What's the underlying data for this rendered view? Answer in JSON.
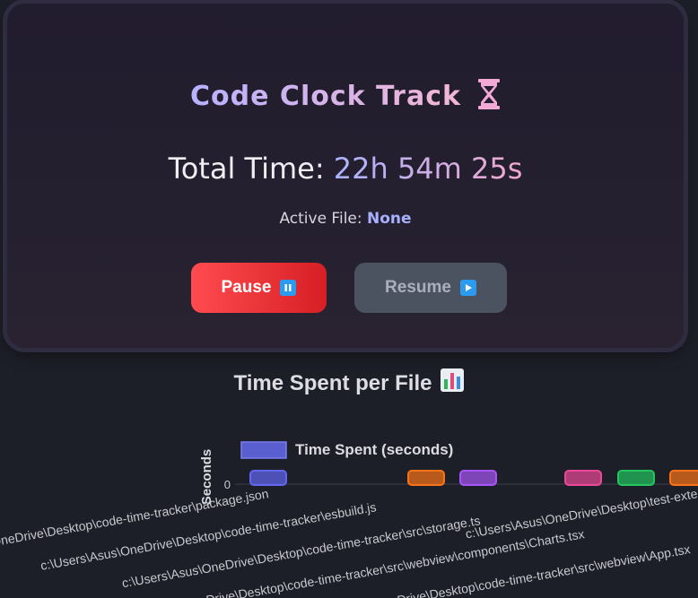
{
  "app": {
    "title": "Code Clock Track",
    "title_icon": "hourglass-icon"
  },
  "stats": {
    "total_label": "Total Time:",
    "total_value": "22h 54m 25s",
    "active_label": "Active File:",
    "active_value": "None"
  },
  "controls": {
    "pause_label": "Pause",
    "pause_icon": "pause-icon",
    "resume_label": "Resume",
    "resume_icon": "play-icon"
  },
  "chart_section": {
    "title": "Time Spent per File",
    "title_icon": "bar-chart-icon"
  },
  "colors": {
    "pause_bg": "#e53236",
    "resume_bg": "#4b5361",
    "accent": "#a7b1ff"
  },
  "chart_data": {
    "type": "bar",
    "legend": "Time Spent (seconds)",
    "legend_placement": "top",
    "ylabel": "Seconds",
    "yticks": [
      "0"
    ],
    "categories": [
      "c:\\Users\\Asus\\OneDrive\\Desktop\\code-time-tracker\\package.json",
      "c:\\Users\\Asus\\OneDrive\\Desktop\\code-time-tracker\\esbuild.js",
      "c:\\Users\\Asus\\OneDrive\\Desktop\\code-time-tracker\\src\\storage.ts",
      "c:\\Users\\Asus\\OneDrive\\Desktop\\code-time-tracker\\src\\webview\\components\\Charts.tsx",
      "c:\\Users\\Asus\\OneDrive\\Desktop\\code-time-tracker\\src\\webview\\App.tsx",
      "c:\\Users\\Asus\\OneDrive\\Desktop\\test-exte"
    ],
    "series": [
      {
        "name": "Time Spent (seconds)",
        "colors": [
          "#6366f1",
          "#f97316",
          "#a855f7",
          "#ec4899",
          "#22c55e",
          "#f97316"
        ]
      }
    ]
  }
}
